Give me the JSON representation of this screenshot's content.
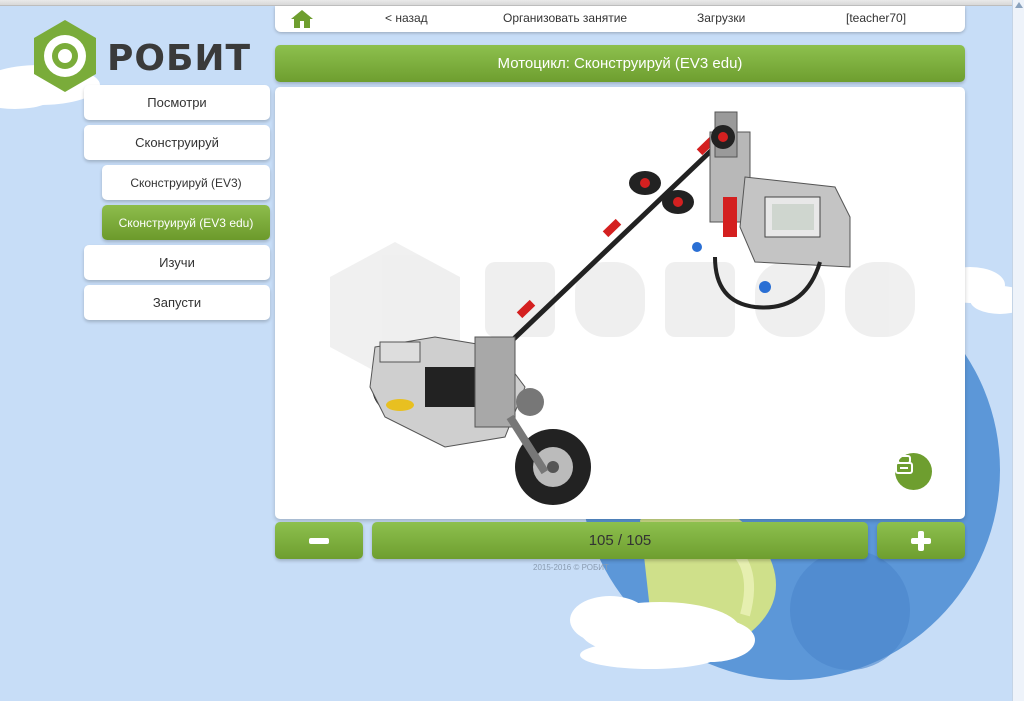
{
  "nav": {
    "back": "< назад",
    "organize": "Организовать занятие",
    "downloads": "Загрузки",
    "user": "[teacher70]"
  },
  "logo": {
    "text": "РОБИТ"
  },
  "sidebar": {
    "items": [
      {
        "label": "Посмотри"
      },
      {
        "label": "Сконструируй"
      },
      {
        "label": "Сконструируй (EV3)"
      },
      {
        "label": "Сконструируй (EV3 edu)"
      },
      {
        "label": "Изучи"
      },
      {
        "label": "Запусти"
      }
    ]
  },
  "page": {
    "title": "Мотоцикл: Сконструируй (EV3 edu)"
  },
  "step": {
    "counter": "105 / 105",
    "current": 105,
    "total": 105
  },
  "footer": {
    "copyright": "2015-2016 © РОБИТ"
  },
  "colors": {
    "accent": "#7aac3a",
    "background": "#c7ddf7",
    "panel": "#ffffff"
  },
  "icons": {
    "home": "home-icon",
    "minus": "minus-icon",
    "plus": "plus-icon",
    "view": "cube-view-icon",
    "logo": "robit-hex-logo-icon"
  }
}
